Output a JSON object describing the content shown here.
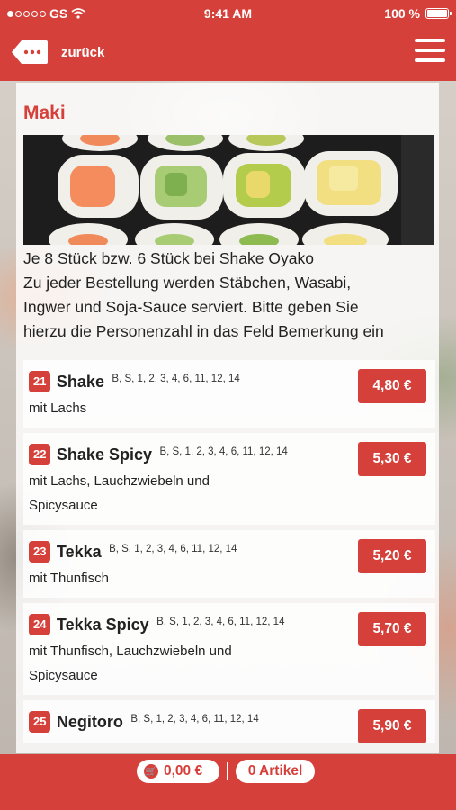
{
  "status_bar": {
    "carrier": "GS",
    "time": "9:41 AM",
    "battery": "100 %"
  },
  "navbar": {
    "back_label": "zurück"
  },
  "section": {
    "title": "Maki",
    "intro_lines": [
      "Je 8 Stück bzw. 6 Stück bei Shake Oyako",
      "Zu jeder Bestellung werden Stäbchen, Wasabi,",
      "Ingwer und Soja-Sauce serviert. Bitte geben Sie",
      "hierzu die Personenzahl in das Feld Bemerkung ein"
    ]
  },
  "items": [
    {
      "number": "21",
      "name": "Shake",
      "allergens": "B, S, 1, 2, 3, 4, 6, 11, 12, 14",
      "description": "mit Lachs",
      "price": "4,80 €"
    },
    {
      "number": "22",
      "name": "Shake Spicy",
      "allergens": "B, S, 1, 2, 3, 4, 6, 11, 12, 14",
      "description": "mit Lachs, Lauchzwiebeln und Spicysauce",
      "price": "5,30 €"
    },
    {
      "number": "23",
      "name": "Tekka",
      "allergens": "B, S, 1, 2, 3, 4, 6, 11, 12, 14",
      "description": "mit Thunfisch",
      "price": "5,20 €"
    },
    {
      "number": "24",
      "name": "Tekka Spicy",
      "allergens": "B, S, 1, 2, 3, 4, 6, 11, 12, 14",
      "description": "mit Thunfisch, Lauchzwiebeln und Spicysauce",
      "price": "5,70 €"
    },
    {
      "number": "25",
      "name": "Negitoro",
      "allergens": "B, S, 1, 2, 3, 4, 6, 11, 12, 14",
      "description": "",
      "price": "5,90 €"
    }
  ],
  "cart": {
    "total": "0,00 €",
    "articles": "0 Artikel"
  },
  "icons": {
    "back": "back-arrow-icon",
    "menu": "hamburger-menu-icon",
    "cart": "cart-icon",
    "wifi": "wifi-icon",
    "battery": "battery-icon"
  },
  "colors": {
    "accent": "#d6403a"
  }
}
